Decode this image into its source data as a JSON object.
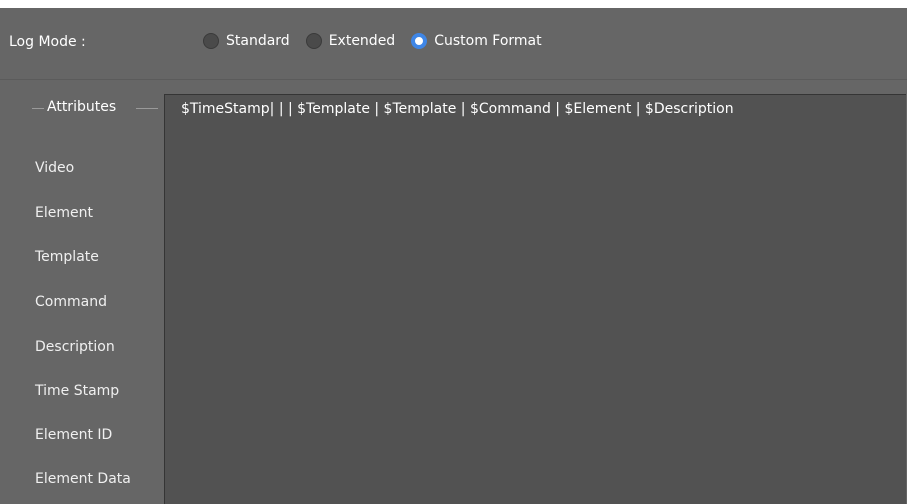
{
  "log_mode": {
    "label": "Log Mode :",
    "options": [
      {
        "label": "Standard",
        "selected": false
      },
      {
        "label": "Extended",
        "selected": false
      },
      {
        "label": "Custom Format",
        "selected": true
      }
    ]
  },
  "attributes": {
    "title": "Attributes",
    "items": [
      "Video",
      "Element",
      "Template",
      "Command",
      "Description",
      "Time Stamp",
      "Element ID",
      "Element Data"
    ]
  },
  "format": {
    "value": "$TimeStamp| | | $Template | $Template | $Command | $Element | $Description"
  },
  "colors": {
    "background": "#666666",
    "text_area": "#525252",
    "radio_selected": "#3f86e6"
  }
}
